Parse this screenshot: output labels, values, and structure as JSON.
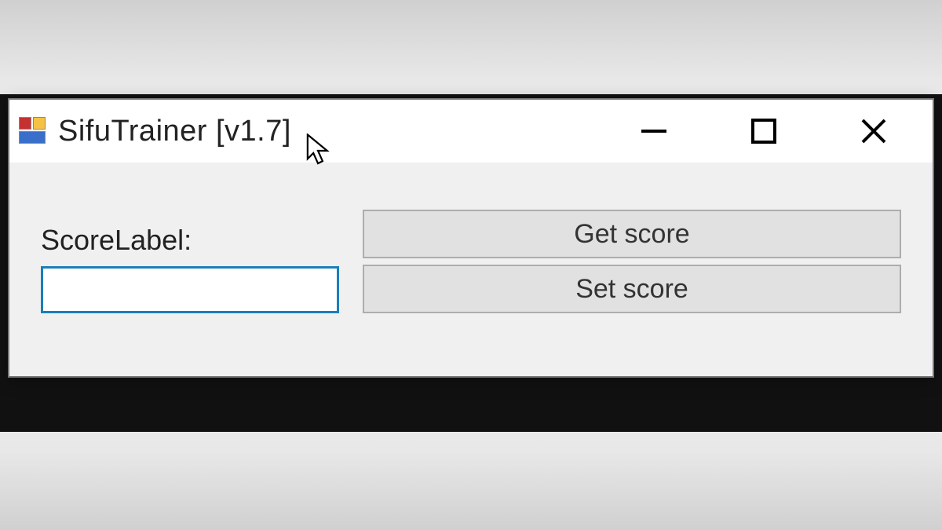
{
  "window": {
    "title": "SifuTrainer [v1.7]"
  },
  "form": {
    "score_label": "ScoreLabel:",
    "score_value": "",
    "get_score_label": "Get score",
    "set_score_label": "Set score"
  }
}
